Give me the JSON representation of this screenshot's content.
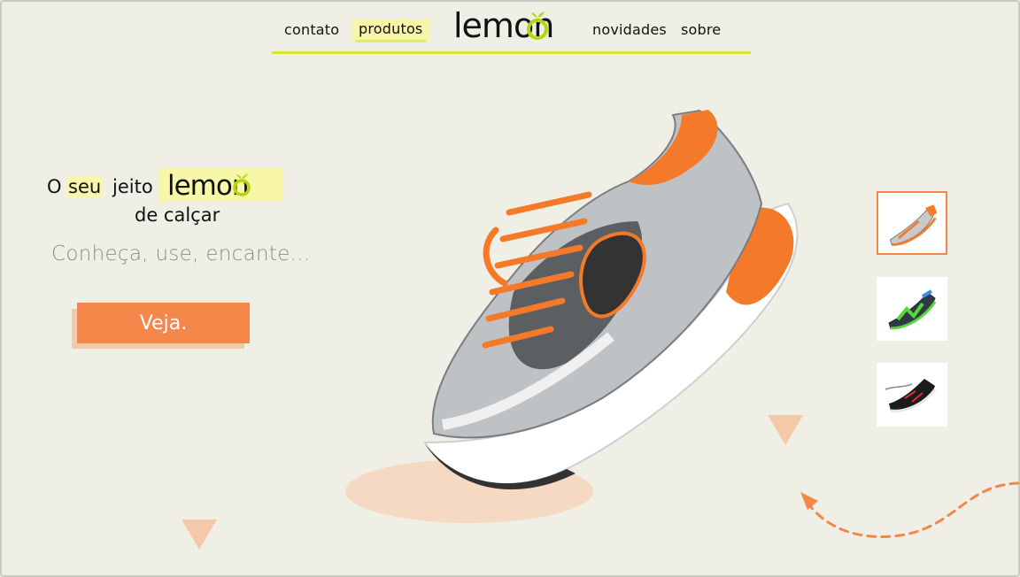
{
  "nav": {
    "items": [
      "contato",
      "produtos",
      "novidades",
      "sobre"
    ],
    "active": "produtos",
    "logo_text": "lemon"
  },
  "hero": {
    "line1_o": "O",
    "line1_seu": "seu",
    "line1_jeito": "jeito",
    "logo_text": "lemon",
    "line2": "de calçar",
    "tagline": "Conheça, use, encante...",
    "cta_label": "Veja."
  },
  "thumbnails": [
    {
      "icon": "orange-running-shoe",
      "active": true
    },
    {
      "icon": "green-blue-trail-shoe",
      "active": false
    },
    {
      "icon": "black-red-sneaker",
      "active": false
    }
  ],
  "colors": {
    "background": "#f0efe5",
    "accent_orange": "#f5874a",
    "accent_yellow": "#f8f6a8",
    "nav_underline": "#d6e530",
    "lemon_green": "#b6d40f"
  }
}
